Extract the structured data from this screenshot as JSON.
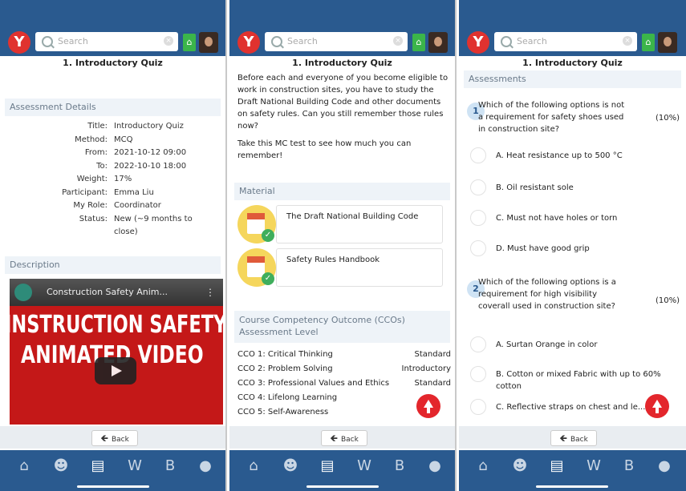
{
  "header": {
    "logo_letter": "Y",
    "search_placeholder": "Search",
    "home_icon": "home-icon",
    "colors": {
      "topbar": "#2a5a8f",
      "accent_red": "#e3262c",
      "home_green": "#3bb54a"
    }
  },
  "quiz_title": "1. Introductory Quiz",
  "screen1": {
    "details_header": "Assessment Details",
    "details": [
      {
        "label": "Title:",
        "value": "Introductory Quiz"
      },
      {
        "label": "Method:",
        "value": "MCQ"
      },
      {
        "label": "From:",
        "value": "2021-10-12 09:00"
      },
      {
        "label": "To:",
        "value": "2022-10-10 18:00"
      },
      {
        "label": "Weight:",
        "value": "17%"
      },
      {
        "label": "Participant:",
        "value": "Emma Liu"
      },
      {
        "label": "My Role:",
        "value": "Coordinator"
      },
      {
        "label": "Status:",
        "value": "New (~9 months to"
      },
      {
        "label": "",
        "value": "close)"
      }
    ],
    "description_header": "Description",
    "video": {
      "title": "Construction Safety Anim...",
      "big_line1": "INSTRUCTION SAFETY",
      "big_line2": "ANIMATED VIDEO"
    }
  },
  "screen2": {
    "intro_paragraph": "Before each and everyone of you become eligible to work in construction sites, you have to study the Draft National Building Code and other documents on safety rules. Can you still remember those rules now?",
    "intro_paragraph2": "Take this MC test to see how much you can remember!",
    "material_header": "Material",
    "materials": [
      {
        "title": "The Draft National Building Code"
      },
      {
        "title": "Safety Rules Handbook"
      }
    ],
    "cco_header_line1": "Course Competency Outcome (CCOs)",
    "cco_header_line2": "Assessment Level",
    "ccos": [
      {
        "name": "CCO 1: Critical Thinking",
        "level": "Standard"
      },
      {
        "name": "CCO 2: Problem Solving",
        "level": "Introductory"
      },
      {
        "name": "CCO 3: Professional Values and Ethics",
        "level": "Standard"
      },
      {
        "name": "CCO 4: Lifelong Learning",
        "level": ""
      },
      {
        "name": "CCO 5: Self-Awareness",
        "level": ""
      }
    ]
  },
  "screen3": {
    "assessments_header": "Assessments",
    "questions": [
      {
        "number": "1",
        "text": "Which of the following options is not a requirement for safety shoes used in construction site?",
        "weight": "(10%)",
        "options": [
          "A. Heat resistance up to 500 °C",
          "B. Oil resistant sole",
          "C. Must not have holes or torn",
          "D. Must have good grip"
        ]
      },
      {
        "number": "2",
        "text": "Which of the following options is a requirement for high visibility coverall used in construction site?",
        "weight": "(10%)",
        "options": [
          "A. Surtan Orange in color",
          "B. Cotton or mixed Fabric with up to 60% cotton",
          "C. Reflective straps on chest and le...lly"
        ]
      }
    ]
  },
  "back_label": "Back",
  "tabs": [
    "home-icon",
    "people-icon",
    "clipboard-icon",
    "w-icon",
    "b-icon",
    "chat-icon"
  ]
}
